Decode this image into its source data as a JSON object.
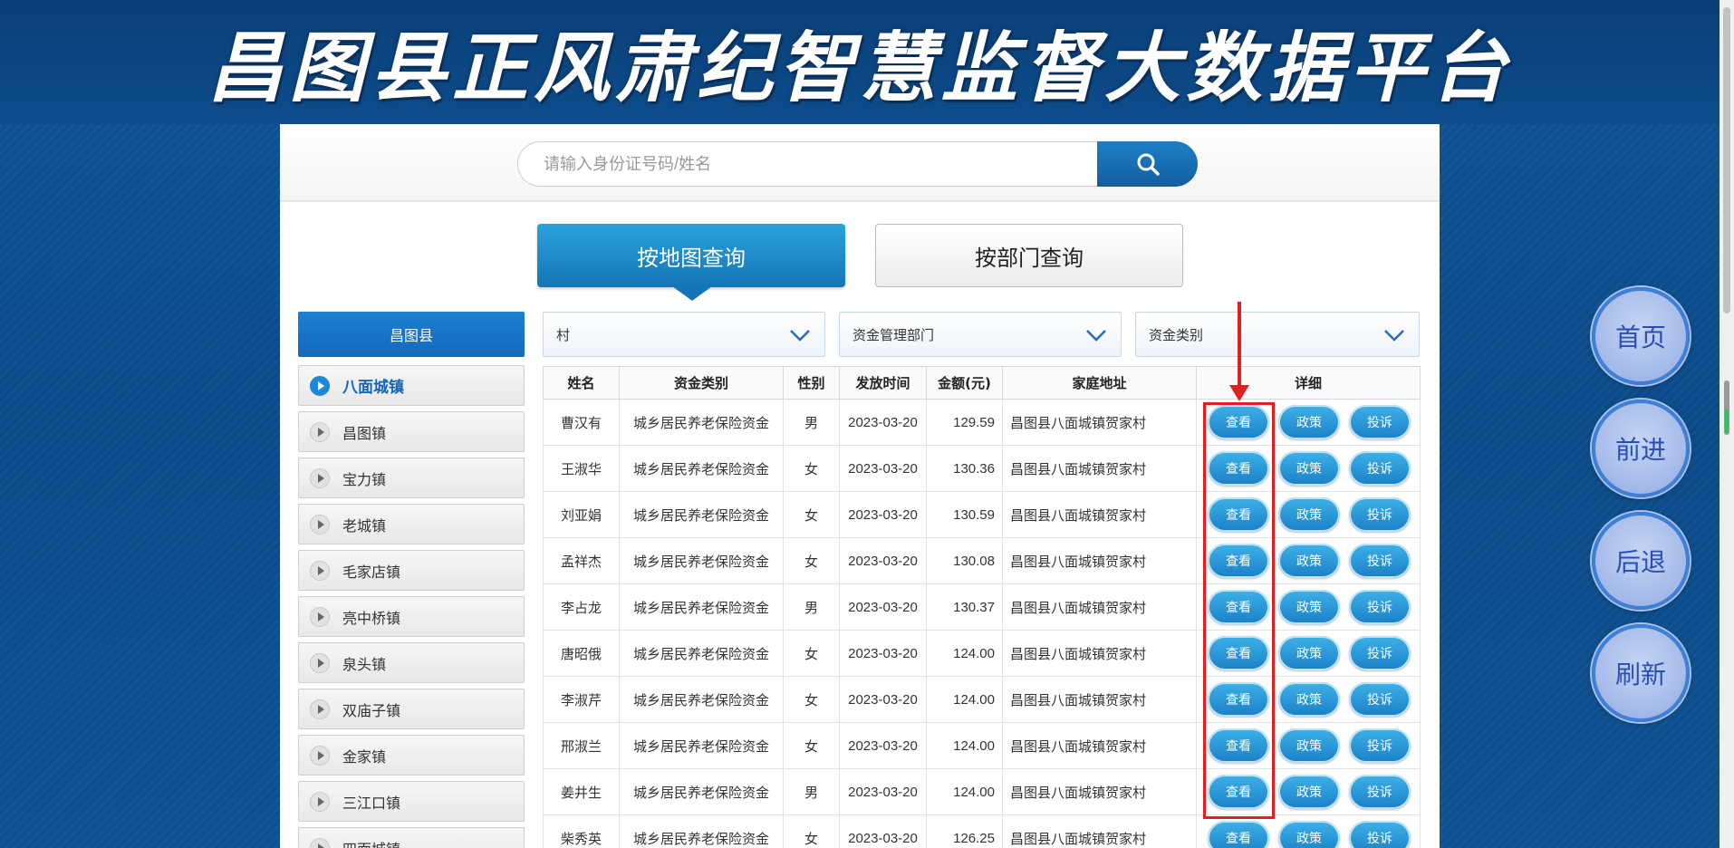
{
  "header": {
    "title": "昌图县正风肃纪智慧监督大数据平台"
  },
  "search": {
    "placeholder": "请输入身份证号码/姓名",
    "value": ""
  },
  "tabs": {
    "map": "按地图查询",
    "dept": "按部门查询"
  },
  "sidebar": {
    "county": "昌图县",
    "towns": [
      "八面城镇",
      "昌图镇",
      "宝力镇",
      "老城镇",
      "毛家店镇",
      "亮中桥镇",
      "泉头镇",
      "双庙子镇",
      "金家镇",
      "三江口镇",
      "四面城镇"
    ],
    "active_town": "八面城镇"
  },
  "filters": {
    "village": "村",
    "department": "资金管理部门",
    "fund_type": "资金类别"
  },
  "table": {
    "headers": [
      "姓名",
      "资金类别",
      "性别",
      "发放时间",
      "金额(元)",
      "家庭地址",
      "详细"
    ],
    "actions": {
      "view": "查看",
      "policy": "政策",
      "complaint": "投诉"
    },
    "rows": [
      [
        "曹汉有",
        "城乡居民养老保险资金",
        "男",
        "2023-03-20",
        "129.59",
        "昌图县八面城镇贺家村"
      ],
      [
        "王淑华",
        "城乡居民养老保险资金",
        "女",
        "2023-03-20",
        "130.36",
        "昌图县八面城镇贺家村"
      ],
      [
        "刘亚娟",
        "城乡居民养老保险资金",
        "女",
        "2023-03-20",
        "130.59",
        "昌图县八面城镇贺家村"
      ],
      [
        "孟祥杰",
        "城乡居民养老保险资金",
        "女",
        "2023-03-20",
        "130.08",
        "昌图县八面城镇贺家村"
      ],
      [
        "李占龙",
        "城乡居民养老保险资金",
        "男",
        "2023-03-20",
        "130.37",
        "昌图县八面城镇贺家村"
      ],
      [
        "唐昭俄",
        "城乡居民养老保险资金",
        "女",
        "2023-03-20",
        "124.00",
        "昌图县八面城镇贺家村"
      ],
      [
        "李淑芹",
        "城乡居民养老保险资金",
        "女",
        "2023-03-20",
        "124.00",
        "昌图县八面城镇贺家村"
      ],
      [
        "邢淑兰",
        "城乡居民养老保险资金",
        "女",
        "2023-03-20",
        "124.00",
        "昌图县八面城镇贺家村"
      ],
      [
        "姜井生",
        "城乡居民养老保险资金",
        "男",
        "2023-03-20",
        "124.00",
        "昌图县八面城镇贺家村"
      ],
      [
        "柴秀英",
        "城乡居民养老保险资金",
        "女",
        "2023-03-20",
        "126.25",
        "昌图县八面城镇贺家村"
      ]
    ]
  },
  "nav": {
    "home": "首页",
    "forward": "前进",
    "back": "后退",
    "refresh": "刷新"
  },
  "colors": {
    "primary": "#1d7fc4",
    "highlight": "#e02020",
    "nav": "#a8bdea"
  },
  "icons": {
    "search": "search-icon",
    "chevron": "chevron-down-icon",
    "play": "play-icon"
  }
}
